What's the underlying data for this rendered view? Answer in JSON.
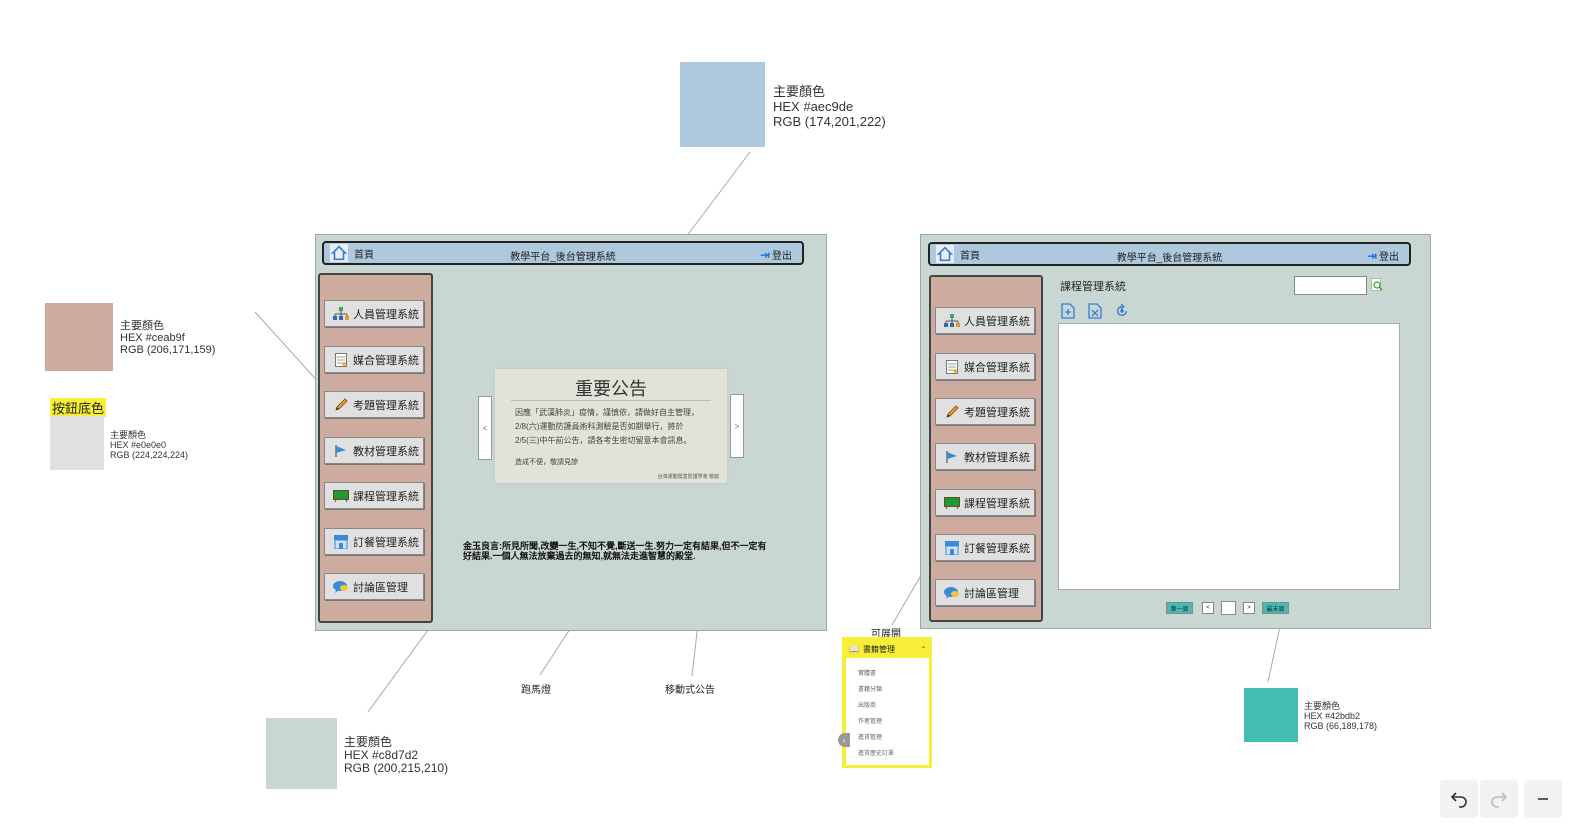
{
  "swatches": {
    "blue": {
      "title": "主要顏色",
      "hex": "HEX #aec9de",
      "rgb": "RGB (174,201,222)",
      "color": "#aec9de"
    },
    "pink": {
      "title": "主要顏色",
      "hex": "HEX #ceab9f",
      "rgb": "RGB (206,171,159)",
      "color": "#ceab9f"
    },
    "gray": {
      "title": "主要顏色",
      "hex": "HEX #e0e0e0",
      "rgb": "RGB (224,224,224)",
      "color": "#e0e0e0"
    },
    "green": {
      "title": "主要顏色",
      "hex": "HEX #c8d7d2",
      "rgb": "RGB (200,215,210)",
      "color": "#c8d7d2"
    },
    "teal": {
      "title": "主要顏色",
      "hex": "HEX #42bdb2",
      "rgb": "RGB (66,189,178)",
      "color": "#42bdb2"
    }
  },
  "button_bg_label": "按鈕底色",
  "app": {
    "home_label": "首頁",
    "title": "教學平台_後台管理系統",
    "logout_label": "登出",
    "menu": [
      {
        "label": "人員管理系統",
        "icon": "org-chart-icon"
      },
      {
        "label": "媒合管理系統",
        "icon": "document-icon"
      },
      {
        "label": "考題管理系統",
        "icon": "pencil-icon"
      },
      {
        "label": "教材管理系統",
        "icon": "flag-icon"
      },
      {
        "label": "課程管理系統",
        "icon": "blackboard-icon"
      },
      {
        "label": "訂餐管理系統",
        "icon": "store-icon"
      },
      {
        "label": "討論區管理",
        "icon": "chat-bubble-icon"
      }
    ]
  },
  "notice": {
    "title": "重要公告",
    "line1": "因應「武漢肺炎」疫情，謹慎依，請做好自主管理，",
    "line2": "2/8(六)運動防護員術科測驗是否如期舉行，將於",
    "line3": "2/5(三)中午前公告，請各考生密切留意本會訊息。",
    "line4": "造成不便，敬請見諒",
    "signature": "台灣運動傷害防護學會 敬啟",
    "prev": "<",
    "next": ">"
  },
  "marquee_text": "金玉良言:所見所聞,改變一生,不知不覺,斷送一生.努力一定有結果,但不一定有好結果.一個人無法放棄過去的無知,就無法走進智慧的殿堂.",
  "captions": {
    "marquee": "跑馬燈",
    "notice": "移動式公告",
    "expandable": "可展開"
  },
  "course_page": {
    "heading": "課程管理系統",
    "pager": {
      "first": "第一頁",
      "prev": "<",
      "next": ">",
      "last": "最末頁",
      "page": ""
    }
  },
  "dropdown": {
    "title": "書籍管理",
    "items": [
      "實體書",
      "書籍分類",
      "出版商",
      "作者管理",
      "進貨管理",
      "進貨歷史訂單"
    ]
  },
  "toolbar": {
    "undo": "undo-icon",
    "redo": "redo-icon",
    "minus": "minus-icon"
  }
}
